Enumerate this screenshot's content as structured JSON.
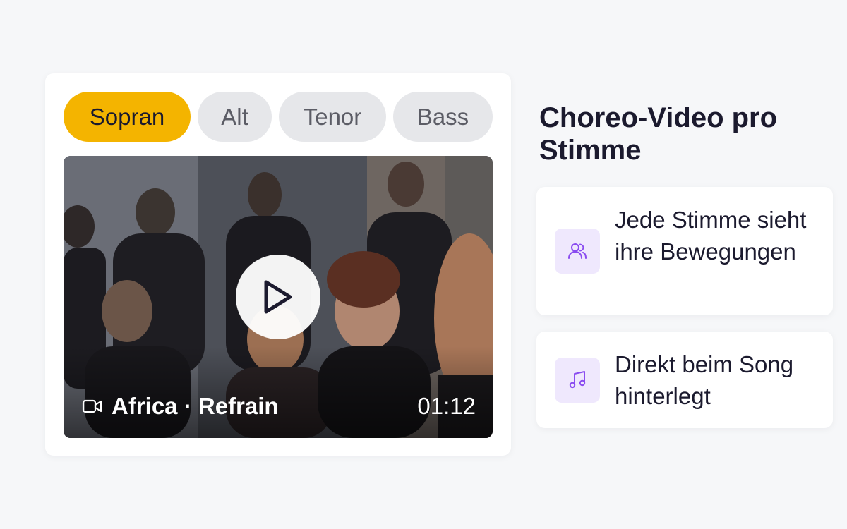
{
  "tabs": [
    {
      "label": "Sopran",
      "active": true
    },
    {
      "label": "Alt",
      "active": false
    },
    {
      "label": "Tenor",
      "active": false
    },
    {
      "label": "Bass",
      "active": false
    }
  ],
  "video": {
    "title": "Africa · Refrain",
    "duration": "01:12",
    "camera_icon": "video-camera-icon",
    "play_icon": "play-icon"
  },
  "heading": "Choreo-Video pro Stimme",
  "features": [
    {
      "icon": "users-icon",
      "text": "Jede Stimme sieht ihre Bewegungen"
    },
    {
      "icon": "music-note-icon",
      "text": "Direkt beim Song hinterlegt"
    }
  ],
  "colors": {
    "accent": "#f4b400",
    "icon_bg": "#efe8fd",
    "icon_fg": "#8a4cf0",
    "tab_bg": "#e6e7ea",
    "page_bg": "#f6f7f9"
  }
}
